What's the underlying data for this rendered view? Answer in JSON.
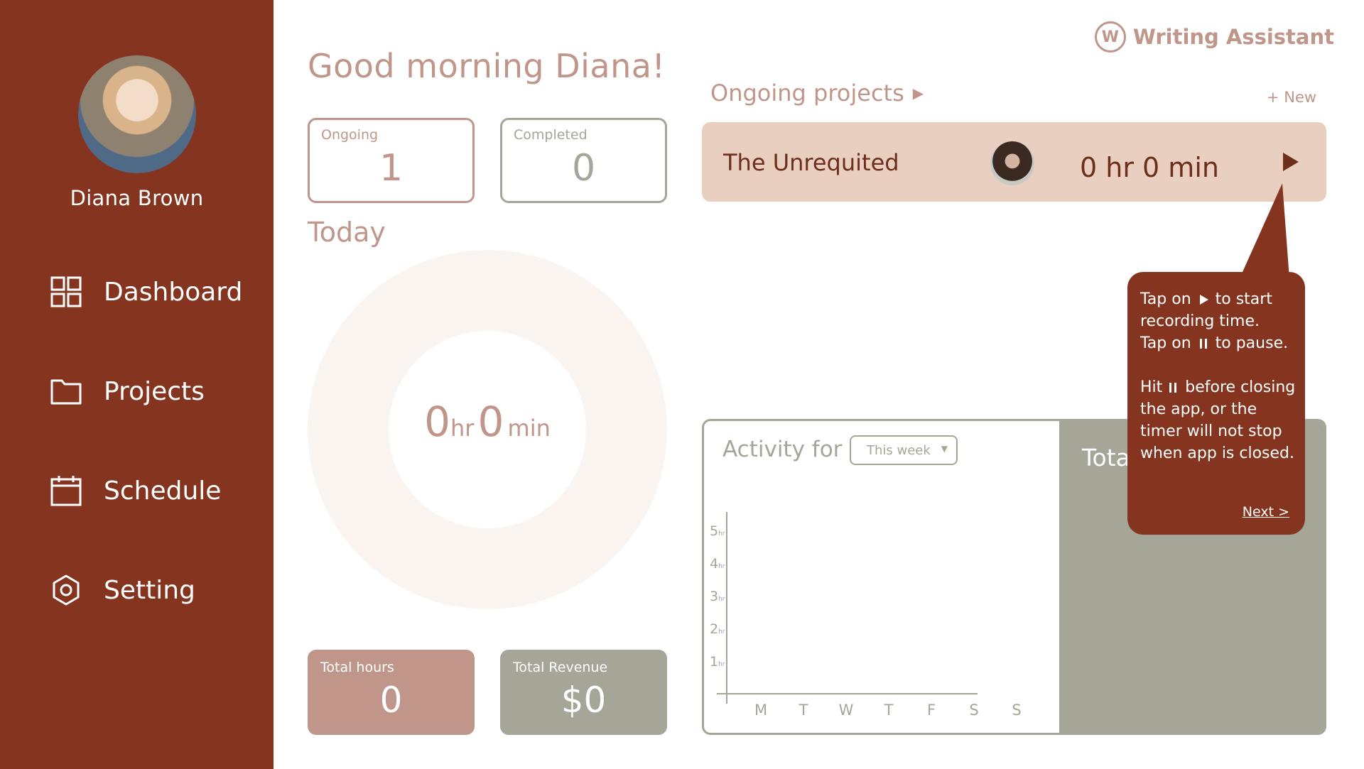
{
  "app": {
    "brand_name": "Writing Assistant",
    "brand_logo_letter": "W"
  },
  "sidebar": {
    "user_name": "Diana Brown",
    "items": [
      {
        "label": "Dashboard",
        "icon": "dashboard-grid-icon"
      },
      {
        "label": "Projects",
        "icon": "folder-icon"
      },
      {
        "label": "Schedule",
        "icon": "calendar-icon"
      },
      {
        "label": "Setting",
        "icon": "settings-hexagon-icon"
      }
    ]
  },
  "greeting": "Good morning Diana!",
  "stats": {
    "ongoing": {
      "label": "Ongoing",
      "value": "1"
    },
    "completed": {
      "label": "Completed",
      "value": "0"
    }
  },
  "today": {
    "title": "Today",
    "hours": "0",
    "hours_unit": "hr",
    "minutes": "0",
    "minutes_unit": "min"
  },
  "totals": {
    "hours": {
      "label": "Total hours",
      "value": "0"
    },
    "revenue": {
      "label": "Total Revenue",
      "value": "$0"
    }
  },
  "ongoing_projects": {
    "title": "Ongoing projects",
    "new_label": "+ New",
    "items": [
      {
        "name": "The Unrequited",
        "time": "0 hr 0 min"
      }
    ]
  },
  "activity": {
    "title": "Activity for",
    "range": "This week",
    "right_panel_label": "Tota"
  },
  "chart_data": {
    "type": "bar",
    "categories": [
      "M",
      "T",
      "W",
      "T",
      "F",
      "S",
      "S"
    ],
    "values": [
      0,
      0,
      0,
      0,
      0,
      0,
      0
    ],
    "y_ticks": [
      {
        "value": "1",
        "unit": "hr"
      },
      {
        "value": "2",
        "unit": "hr"
      },
      {
        "value": "3",
        "unit": "hr"
      },
      {
        "value": "4",
        "unit": "hr"
      },
      {
        "value": "5",
        "unit": "hr"
      }
    ],
    "ylim": [
      0,
      5
    ]
  },
  "tooltip": {
    "line1_pre": "Tap on",
    "line1_post": "to start",
    "line2": "recording time.",
    "line3_pre": "Tap on",
    "line3_post": "to pause.",
    "line4_pre": "Hit",
    "line4_post": "before closing",
    "line5": "the app, or the",
    "line6": "timer will not stop",
    "line7": "when app is closed.",
    "next_label": "Next >"
  },
  "colors": {
    "sidebar": "#85351f",
    "accent_rose": "#c0968a",
    "accent_sage": "#a5a598",
    "project_card": "#e8cfc0",
    "donut_ring": "#fbf5f1"
  }
}
